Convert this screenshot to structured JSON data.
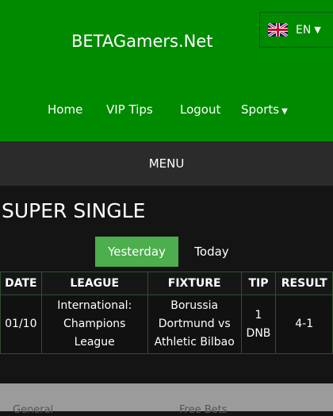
{
  "header": {
    "brand": "BETAGamers.Net",
    "language": {
      "code": "EN",
      "flag": "uk-flag-icon"
    },
    "nav": [
      {
        "label": "Home"
      },
      {
        "label": "VIP Tips"
      },
      {
        "label": "Logout"
      },
      {
        "label": "Sports",
        "icon": "caret-down-icon"
      }
    ]
  },
  "menu": {
    "label": "MENU"
  },
  "main": {
    "title": "SUPER SINGLE",
    "tabs": [
      {
        "label": "Yesterday",
        "active": true
      },
      {
        "label": "Today",
        "active": false
      }
    ],
    "table": {
      "headers": [
        "DATE",
        "LEAGUE",
        "FIXTURE",
        "TIP",
        "RESULT"
      ],
      "rows": [
        {
          "date": "01/10",
          "league": "International: Champions League",
          "fixture": "Borussia Dortmund vs Athletic Bilbao",
          "tip": "1 DNB",
          "result": "4-1"
        }
      ]
    }
  },
  "footer": {
    "left": "General",
    "right": "Free Bets"
  },
  "colors": {
    "header": "#008a00",
    "active_tab": "#4cae4c",
    "menubar": "#2b2b2b",
    "background": "#141414"
  }
}
